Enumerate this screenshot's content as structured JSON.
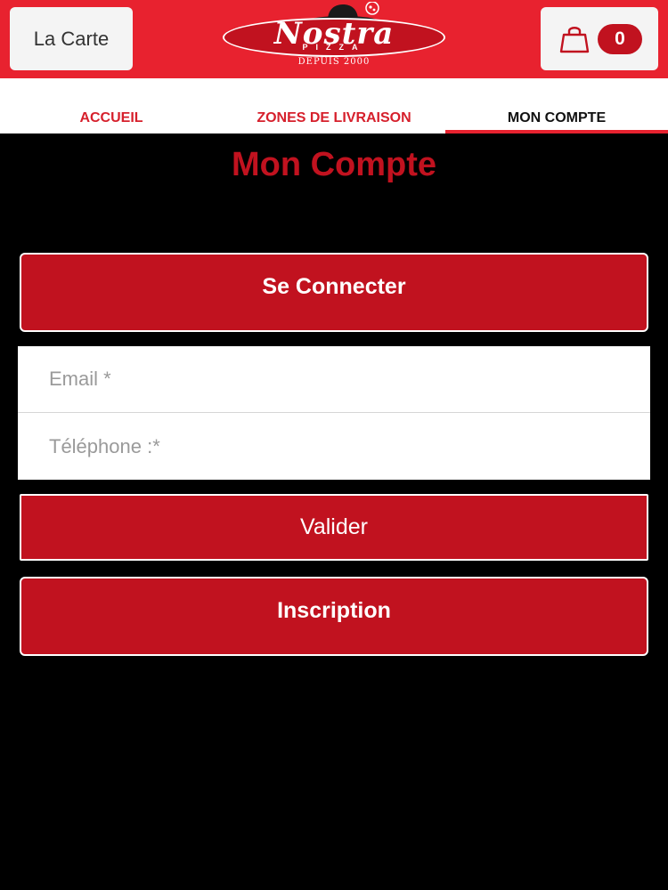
{
  "header": {
    "menu_button_label": "La Carte",
    "cart_count": "0",
    "logo": {
      "brand": "Nostra",
      "sub": "PIZZA",
      "since": "DEPUIS 2000"
    }
  },
  "nav": {
    "tabs": [
      {
        "label": "ACCUEIL",
        "active": false
      },
      {
        "label": "ZONES DE LIVRAISON",
        "active": false
      },
      {
        "label": "MON COMPTE",
        "active": true
      }
    ]
  },
  "main": {
    "title": "Mon Compte",
    "connect_label": "Se Connecter",
    "email_placeholder": "Email *",
    "phone_placeholder": "Téléphone :*",
    "validate_label": "Valider",
    "signup_label": "Inscription"
  },
  "colors": {
    "header_red": "#e8222f",
    "button_red": "#c1121f",
    "background": "#000000"
  },
  "icons": {
    "cart": "shopping-bag-icon",
    "logo_hat": "chef-hat-icon"
  }
}
